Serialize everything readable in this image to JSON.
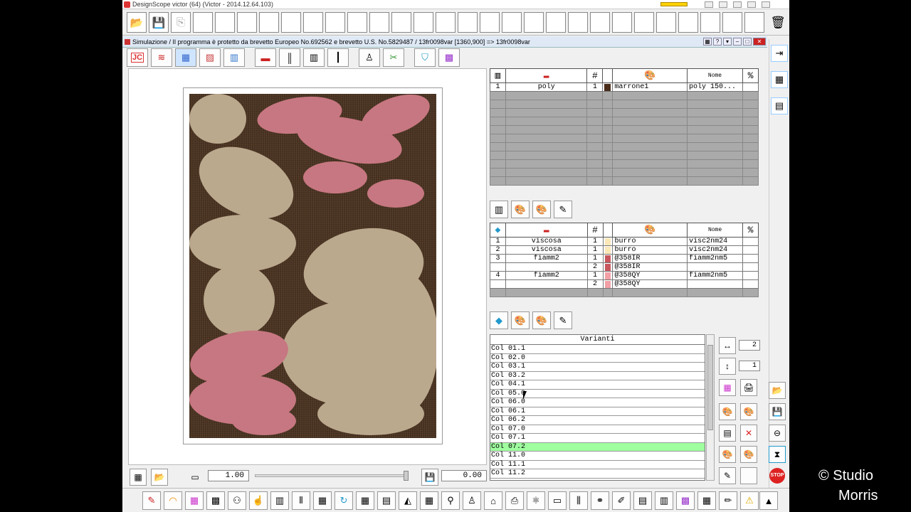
{
  "window": {
    "os_title": "DesignScope victor (64) (Victor - 2014.12.64.103)",
    "sim_title": "Simulazione / Il programma è protetto da brevetto Europeo No.692562 e brevetto U.S. No.5829487  / 13fr0098var [1360,900] => 13fr0098var"
  },
  "colors": {
    "fabric_bg": "#4a3321",
    "pink": "#c77781",
    "beige": "#bba98e",
    "selected": "#9fff9f"
  },
  "toolbar2_icons": [
    "jc-icon",
    "weave-red-blue-icon",
    "color-grid-icon",
    "pattern-icon",
    "jacquard-icon",
    "red-yarn-icon",
    "comb-icon",
    "loom-icon",
    "chart-icon",
    "weight-icon",
    "scissors-icon",
    "shield-icon",
    "palette-grid-icon"
  ],
  "warp_table": {
    "headers": {
      "num": "#",
      "name": "Nome",
      "pct": "%"
    },
    "rows": [
      {
        "idx": "1",
        "yarn": "poly",
        "count": "1",
        "color": "#4a2c1a",
        "color_name": "marrone1",
        "nome": "poly 150..."
      }
    ]
  },
  "weft_table": {
    "headers": {
      "num": "#",
      "name": "Nome",
      "pct": "%"
    },
    "rows": [
      {
        "idx": "1",
        "yarn": "viscosa",
        "count": "1",
        "color": "#fbe8b8",
        "color_name": "burro",
        "nome": "visc2nm24"
      },
      {
        "idx": "2",
        "yarn": "viscosa",
        "count": "1",
        "color": "#fbe8b8",
        "color_name": "burro",
        "nome": "visc2nm24"
      },
      {
        "idx": "3",
        "yarn": "fiamm2",
        "count": "1",
        "color": "#c8585f",
        "color_name": "@358IR",
        "nome": "fiamm2nm5"
      },
      {
        "idx": "",
        "yarn": "",
        "count": "2",
        "color": "#c8585f",
        "color_name": "@358IR",
        "nome": ""
      },
      {
        "idx": "4",
        "yarn": "fiamm2",
        "count": "1",
        "color": "#f2a0a6",
        "color_name": "@358QY",
        "nome": "fiamm2nm5"
      },
      {
        "idx": "",
        "yarn": "",
        "count": "2",
        "color": "#f2a0a6",
        "color_name": "@358QY",
        "nome": ""
      }
    ]
  },
  "varianti": {
    "header": "Varianti",
    "items": [
      "Col 01.1",
      "Col 02.0",
      "Col 03.1",
      "Col 03.2",
      "Col 04.1",
      "Col 05.0",
      "Col 06.0",
      "Col 06.1",
      "Col 06.2",
      "Col 07.0",
      "Col 07.1",
      "Col 07.2",
      "Col 11.0",
      "Col 11.1",
      "Col 11.2"
    ],
    "selected_index": 11
  },
  "side_values": {
    "top": "2",
    "bottom": "1"
  },
  "bottom_controls": {
    "zoom": "1.00",
    "offset": "0.00",
    "slider_fraction": 1.0
  },
  "watermark": {
    "line1": "© Studio",
    "line2": "Morris"
  }
}
